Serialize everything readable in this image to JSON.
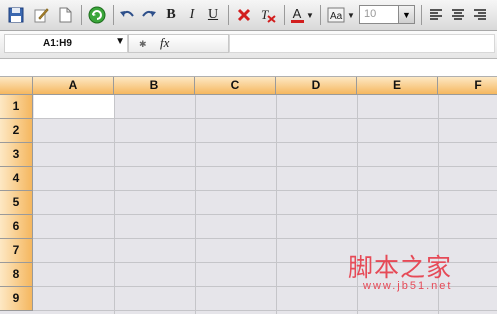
{
  "toolbar": {
    "bold": "B",
    "italic": "I",
    "underline": "U",
    "font_color": "A",
    "font_size": "10"
  },
  "formula_bar": {
    "cell_ref": "A1:H9",
    "fx_label": "fx",
    "formula_value": ""
  },
  "grid": {
    "columns": [
      "A",
      "B",
      "C",
      "D",
      "E",
      "F"
    ],
    "rows": [
      "1",
      "2",
      "3",
      "4",
      "5",
      "6",
      "7",
      "8",
      "9"
    ],
    "header_color": "#f5b75f",
    "cell_background": "#e6e5ea"
  },
  "watermark": {
    "title": "脚本之家",
    "url": "www.jb51.net"
  }
}
